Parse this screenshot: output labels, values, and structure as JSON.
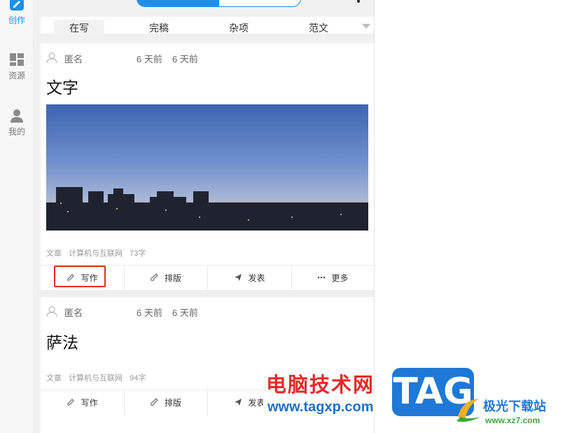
{
  "sidebar": {
    "items": [
      {
        "label": "创作",
        "icon": "edit-icon",
        "active": true
      },
      {
        "label": "资源",
        "icon": "grid-icon",
        "active": false
      },
      {
        "label": "我的",
        "icon": "user-icon",
        "active": false
      }
    ]
  },
  "tabs": [
    "在写",
    "完稿",
    "杂项",
    "范文"
  ],
  "cards": [
    {
      "author": "匿名",
      "time1": "6 天前",
      "time2": "6 天前",
      "title": "文字",
      "category": "文章",
      "tag": "计算机与互联网",
      "word_count": "73字"
    },
    {
      "author": "匿名",
      "time1": "6 天前",
      "time2": "6 天前",
      "title": "萨法",
      "category": "文章",
      "tag": "计算机与互联网",
      "word_count": "94字"
    }
  ],
  "actions": {
    "write": "写作",
    "layout": "排版",
    "publish": "发表",
    "more": "更多"
  },
  "watermark": {
    "cn": "电脑技术网",
    "url": "www.tagxp.com",
    "tag": "TAG",
    "site": "极光下载站",
    "site_url": "www.xz7.com"
  },
  "colors": {
    "accent": "#1e8eea",
    "highlight": "#e02a2a",
    "watermark_red": "#e52a2a",
    "watermark_blue": "#1d78d6"
  }
}
